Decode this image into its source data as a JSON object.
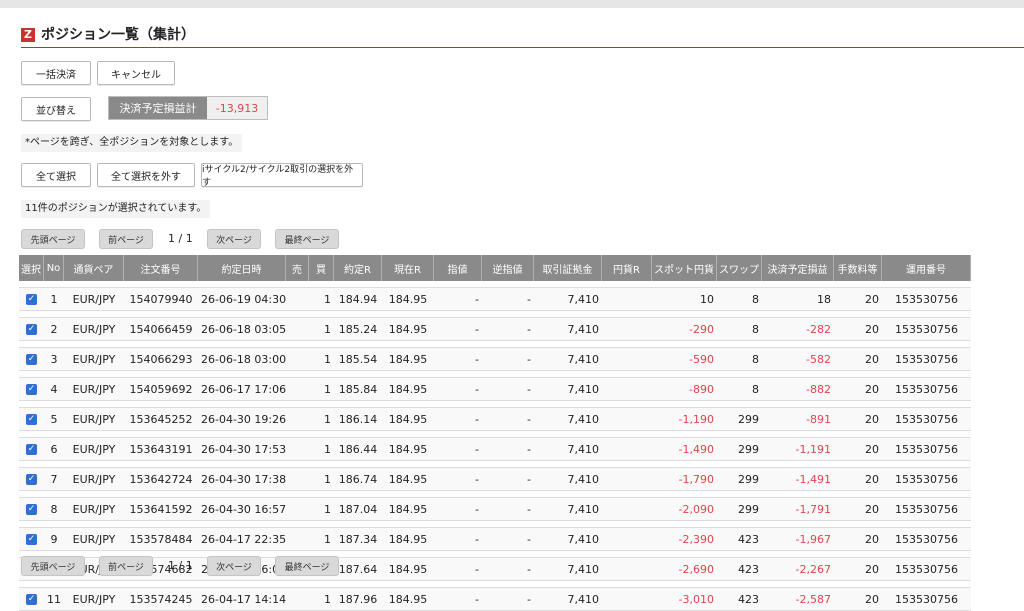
{
  "page": {
    "title": "ポジション一覧（集計）",
    "logo": "Z"
  },
  "toolbar": {
    "bulk_settle": "一括決済",
    "cancel": "キャンセル",
    "sort": "並び替え",
    "summary_label": "決済予定損益計",
    "summary_value": "-13,913"
  },
  "note_pages": "*ページを跨ぎ、全ポジションを対象とします。",
  "select_buttons": {
    "select_all": "全て選択",
    "deselect_all": "全て選択を外す",
    "deselect_cycle": "iサイクル2/サイクル2取引の選択を外す"
  },
  "selected_message": "11件のポジションが選択されています。",
  "pagination": {
    "first": "先頭ページ",
    "prev": "前ページ",
    "count": "1 / 1",
    "next": "次ページ",
    "last": "最終ページ"
  },
  "table": {
    "headers": [
      "選択",
      "No",
      "通貨ペア",
      "注文番号",
      "約定日時",
      "売",
      "買",
      "約定R",
      "現在R",
      "指値",
      "逆指値",
      "取引証拠金",
      "円貨R",
      "スポット円貨",
      "スワップ",
      "決済予定損益",
      "手数料等",
      "運用番号"
    ],
    "rows": [
      {
        "checked": "✓",
        "no": "1",
        "pair": "EUR/JPY",
        "order": "154079940",
        "datetime": "26-06-19 04:30",
        "sell": "",
        "buy": "1",
        "rate": "184.94",
        "current": "184.95",
        "limit": "-",
        "stop": "-",
        "margin": "7,410",
        "yen_rate": "",
        "spot": "10",
        "swap": "8",
        "pl": "18",
        "fee": "20",
        "op": "153530756",
        "spot_neg": false,
        "pl_neg": false
      },
      {
        "checked": "✓",
        "no": "2",
        "pair": "EUR/JPY",
        "order": "154066459",
        "datetime": "26-06-18 03:05",
        "sell": "",
        "buy": "1",
        "rate": "185.24",
        "current": "184.95",
        "limit": "-",
        "stop": "-",
        "margin": "7,410",
        "yen_rate": "",
        "spot": "-290",
        "swap": "8",
        "pl": "-282",
        "fee": "20",
        "op": "153530756",
        "spot_neg": true,
        "pl_neg": true
      },
      {
        "checked": "✓",
        "no": "3",
        "pair": "EUR/JPY",
        "order": "154066293",
        "datetime": "26-06-18 03:00",
        "sell": "",
        "buy": "1",
        "rate": "185.54",
        "current": "184.95",
        "limit": "-",
        "stop": "-",
        "margin": "7,410",
        "yen_rate": "",
        "spot": "-590",
        "swap": "8",
        "pl": "-582",
        "fee": "20",
        "op": "153530756",
        "spot_neg": true,
        "pl_neg": true
      },
      {
        "checked": "✓",
        "no": "4",
        "pair": "EUR/JPY",
        "order": "154059692",
        "datetime": "26-06-17 17:06",
        "sell": "",
        "buy": "1",
        "rate": "185.84",
        "current": "184.95",
        "limit": "-",
        "stop": "-",
        "margin": "7,410",
        "yen_rate": "",
        "spot": "-890",
        "swap": "8",
        "pl": "-882",
        "fee": "20",
        "op": "153530756",
        "spot_neg": true,
        "pl_neg": true
      },
      {
        "checked": "✓",
        "no": "5",
        "pair": "EUR/JPY",
        "order": "153645252",
        "datetime": "26-04-30 19:26",
        "sell": "",
        "buy": "1",
        "rate": "186.14",
        "current": "184.95",
        "limit": "-",
        "stop": "-",
        "margin": "7,410",
        "yen_rate": "",
        "spot": "-1,190",
        "swap": "299",
        "pl": "-891",
        "fee": "20",
        "op": "153530756",
        "spot_neg": true,
        "pl_neg": true
      },
      {
        "checked": "✓",
        "no": "6",
        "pair": "EUR/JPY",
        "order": "153643191",
        "datetime": "26-04-30 17:53",
        "sell": "",
        "buy": "1",
        "rate": "186.44",
        "current": "184.95",
        "limit": "-",
        "stop": "-",
        "margin": "7,410",
        "yen_rate": "",
        "spot": "-1,490",
        "swap": "299",
        "pl": "-1,191",
        "fee": "20",
        "op": "153530756",
        "spot_neg": true,
        "pl_neg": true
      },
      {
        "checked": "✓",
        "no": "7",
        "pair": "EUR/JPY",
        "order": "153642724",
        "datetime": "26-04-30 17:38",
        "sell": "",
        "buy": "1",
        "rate": "186.74",
        "current": "184.95",
        "limit": "-",
        "stop": "-",
        "margin": "7,410",
        "yen_rate": "",
        "spot": "-1,790",
        "swap": "299",
        "pl": "-1,491",
        "fee": "20",
        "op": "153530756",
        "spot_neg": true,
        "pl_neg": true
      },
      {
        "checked": "✓",
        "no": "8",
        "pair": "EUR/JPY",
        "order": "153641592",
        "datetime": "26-04-30 16:57",
        "sell": "",
        "buy": "1",
        "rate": "187.04",
        "current": "184.95",
        "limit": "-",
        "stop": "-",
        "margin": "7,410",
        "yen_rate": "",
        "spot": "-2,090",
        "swap": "299",
        "pl": "-1,791",
        "fee": "20",
        "op": "153530756",
        "spot_neg": true,
        "pl_neg": true
      },
      {
        "checked": "✓",
        "no": "9",
        "pair": "EUR/JPY",
        "order": "153578484",
        "datetime": "26-04-17 22:35",
        "sell": "",
        "buy": "1",
        "rate": "187.34",
        "current": "184.95",
        "limit": "-",
        "stop": "-",
        "margin": "7,410",
        "yen_rate": "",
        "spot": "-2,390",
        "swap": "423",
        "pl": "-1,967",
        "fee": "20",
        "op": "153530756",
        "spot_neg": true,
        "pl_neg": true
      },
      {
        "checked": "✓",
        "no": "10",
        "pair": "EUR/JPY",
        "order": "153574682",
        "datetime": "26-04-17 16:09",
        "sell": "",
        "buy": "1",
        "rate": "187.64",
        "current": "184.95",
        "limit": "-",
        "stop": "-",
        "margin": "7,410",
        "yen_rate": "",
        "spot": "-2,690",
        "swap": "423",
        "pl": "-2,267",
        "fee": "20",
        "op": "153530756",
        "spot_neg": true,
        "pl_neg": true
      },
      {
        "checked": "✓",
        "no": "11",
        "pair": "EUR/JPY",
        "order": "153574245",
        "datetime": "26-04-17 14:14",
        "sell": "",
        "buy": "1",
        "rate": "187.96",
        "current": "184.95",
        "limit": "-",
        "stop": "-",
        "margin": "7,410",
        "yen_rate": "",
        "spot": "-3,010",
        "swap": "423",
        "pl": "-2,587",
        "fee": "20",
        "op": "153530756",
        "spot_neg": true,
        "pl_neg": true
      }
    ]
  },
  "colors": {
    "accent": "#c8322b",
    "negative": "#e0454b",
    "header_bg": "#8a8a8a",
    "checkbox": "#2f6fd1"
  }
}
